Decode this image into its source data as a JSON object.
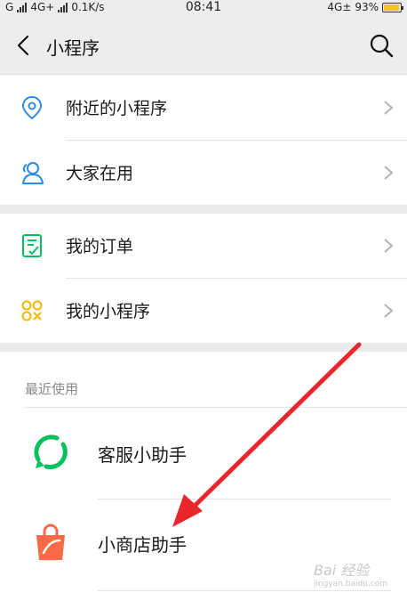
{
  "status_bar": {
    "left_signal_1": "G",
    "network": "4G+",
    "speed": "0.1K/s",
    "time": "08:41",
    "right_network": "4G±",
    "battery": "93%",
    "battery_level": 0.93
  },
  "nav": {
    "title": "小程序",
    "back_icon": "back-arrow-icon",
    "search_icon": "search-icon"
  },
  "menu": {
    "nearby": "附近的小程序",
    "popular": "大家在用",
    "orders": "我的订单",
    "my_miniprograms": "我的小程序"
  },
  "recent": {
    "section_title": "最近使用",
    "items": [
      {
        "label": "客服小助手",
        "icon": "customer-service-icon",
        "color": "#07c160"
      },
      {
        "label": "小商店助手",
        "icon": "shop-bag-icon",
        "color": "#fa6a47"
      }
    ]
  },
  "colors": {
    "accent_blue": "#2b8ce4",
    "accent_green": "#07c160",
    "accent_yellow": "#f5b800",
    "arrow_red": "#e8262c"
  },
  "watermark": {
    "text": "Bai 经验",
    "sub": "jingyan.baidu.com"
  }
}
